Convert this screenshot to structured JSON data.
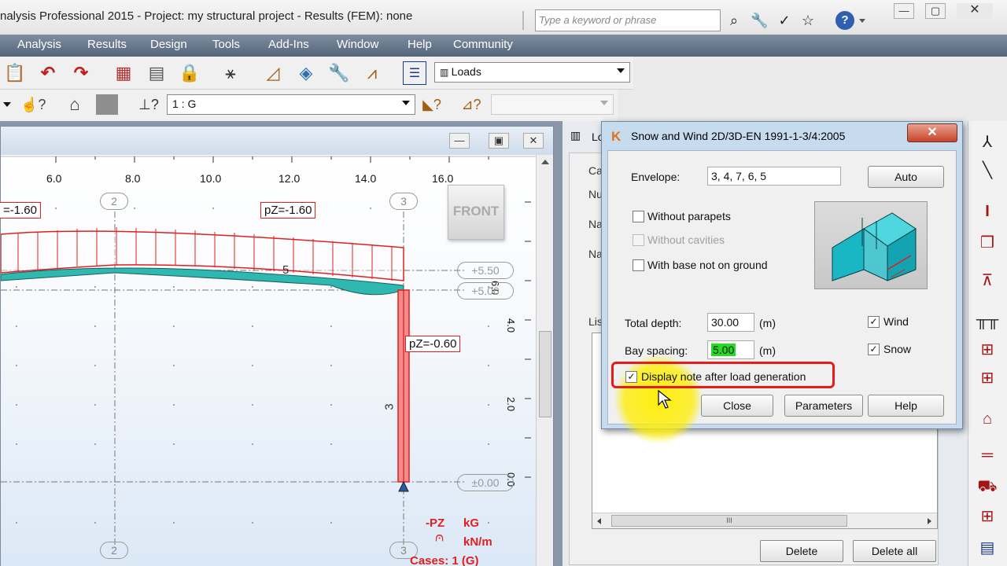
{
  "window": {
    "title": "nalysis Professional 2015 - Project: my structural project - Results (FEM): none",
    "search_placeholder": "Type a keyword or phrase",
    "help_glyph": "?"
  },
  "menu": [
    "Analysis",
    "Results",
    "Design",
    "Tools",
    "Add-Ins",
    "Window",
    "Help",
    "Community"
  ],
  "toolbar": {
    "loads_combo": "Loads",
    "case_combo": "1 : G"
  },
  "view": {
    "front_label": "FRONT",
    "x_ticks": [
      "6.0",
      "8.0",
      "10.0",
      "12.0",
      "14.0",
      "16.0"
    ],
    "y_ticks": [
      "6.0",
      "4.0",
      "2.0",
      "0.0"
    ],
    "grid_labels": [
      "2",
      "3",
      "2",
      "3"
    ],
    "level_labels": [
      "+5.50",
      "+5.00",
      "±0.00"
    ],
    "member_labels": [
      "5",
      "3"
    ],
    "load_tags": [
      "=-1.60",
      "pZ=-1.60",
      "pZ=-0.60"
    ],
    "legend": {
      "direction": "-PZ",
      "unit1": "kG",
      "unit2": "kN/m",
      "cases": "Cases: 1 (G)"
    }
  },
  "loads_panel": {
    "title_fragment": "Lo",
    "side_labels": [
      "Ca",
      "Nu",
      "Na",
      "Na",
      "Lis"
    ],
    "delete_label": "Delete",
    "delete_all_label": "Delete all",
    "scroll_glyph": "III"
  },
  "dialog": {
    "title": "Snow and Wind 2D/3D-EN 1991-1-3/4:2005",
    "close_glyph": "✕",
    "envelope_label": "Envelope:",
    "envelope_value": "3, 4, 7, 6, 5",
    "auto_label": "Auto",
    "checks": [
      {
        "label": "Without parapets",
        "checked": false,
        "enabled": true
      },
      {
        "label": "Without cavities",
        "checked": false,
        "enabled": false
      },
      {
        "label": "With base not on ground",
        "checked": false,
        "enabled": true
      }
    ],
    "total_depth_label": "Total depth:",
    "total_depth_value": "30.00",
    "bay_spacing_label": "Bay spacing:",
    "bay_spacing_value": "5.00",
    "unit_m": "(m)",
    "wind_label": "Wind",
    "snow_label": "Snow",
    "display_note_label": "Display note after load generation",
    "buttons": [
      "Close",
      "Parameters",
      "Help"
    ]
  },
  "colors": {
    "accent_red": "#e02020",
    "member_fill": "#f58a8a",
    "highlight_green": "#22dd22",
    "cursor_highlight": "#ffee00"
  }
}
